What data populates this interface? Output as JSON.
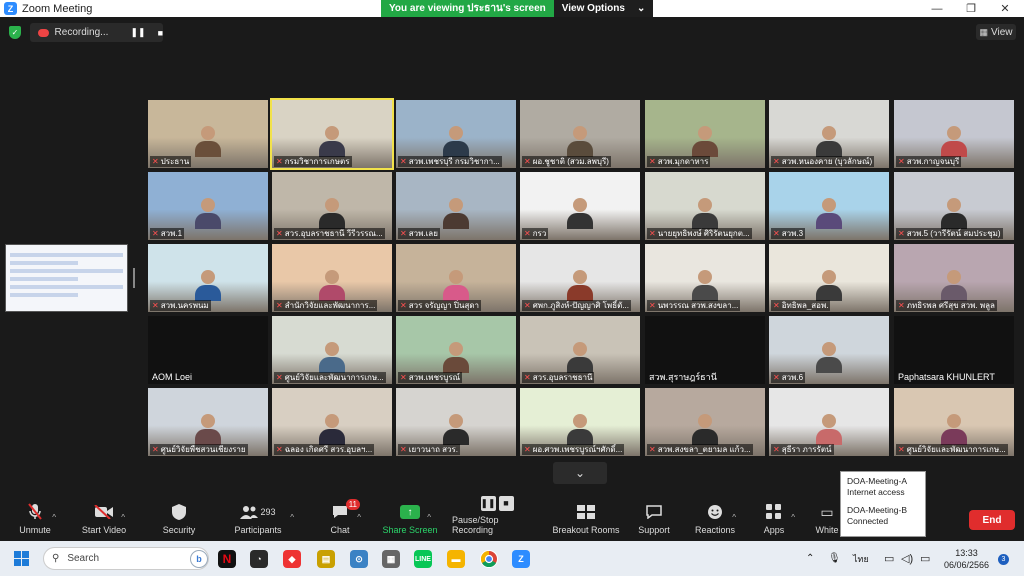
{
  "window": {
    "title": "Zoom Meeting",
    "banner_text": "You are viewing ประธาน's screen",
    "view_options": "View Options"
  },
  "top": {
    "recording_label": "Recording...",
    "view_label": "View"
  },
  "participants": [
    {
      "name": "ประธาน",
      "muted": true
    },
    {
      "name": "กรมวิชาการเกษตร",
      "muted": true
    },
    {
      "name": "สวพ.เพชรบุรี กรมวิชากา...",
      "muted": true
    },
    {
      "name": "ผอ.ชูชาติ (สวม.ลพบุรี)",
      "muted": true
    },
    {
      "name": "สวพ.มุกดาหาร",
      "muted": true
    },
    {
      "name": "สวพ.หนองคาย (บุวลักษณ์)",
      "muted": true
    },
    {
      "name": "สวพ.กาญจนบุรี",
      "muted": true
    },
    {
      "name": "สวพ.1",
      "muted": true
    },
    {
      "name": "สวร.อุบลราชธานี วีรีวรรณ...",
      "muted": true
    },
    {
      "name": "สวพ.เลย",
      "muted": true
    },
    {
      "name": "กรว",
      "muted": true
    },
    {
      "name": "นายยุทธิพงษ์ ศิริรัตนยุกต...",
      "muted": true
    },
    {
      "name": "สวพ.3",
      "muted": true
    },
    {
      "name": "สวพ.5 (วารีรัตน์ สมประชุม)",
      "muted": true
    },
    {
      "name": "สวพ.นครพนม",
      "muted": true
    },
    {
      "name": "สำนักวิจัยและพัฒนาการ...",
      "muted": true
    },
    {
      "name": "สวร จรัญญา ปิ่นสุดา",
      "muted": true
    },
    {
      "name": "ศพก.ภูสิงห์-ปัญญาศิ โพธิ์ตั...",
      "muted": true
    },
    {
      "name": "นพวรรณ สวพ.สงขลา...",
      "muted": true
    },
    {
      "name": "อิทธิพล_สอพ.",
      "muted": true
    },
    {
      "name": "ภทธิรพล ศรีสุข สวพ. พลูล",
      "muted": true
    },
    {
      "name": "AOM Loei",
      "muted": true
    },
    {
      "name": "ศูนย์วิจัยและพัฒนาการเกษ...",
      "muted": true
    },
    {
      "name": "สวพ.เพชรบูรณ์",
      "muted": true
    },
    {
      "name": "สวร.อุบลราชธานี",
      "muted": true
    },
    {
      "name": "สวพ.สุราษฎร์ธานี",
      "muted": true
    },
    {
      "name": "สวพ.6",
      "muted": true
    },
    {
      "name": "Paphatsara KHUNLERT",
      "muted": true
    },
    {
      "name": "ศูนย์วิจัยพืชสวนเชียงราย",
      "muted": true
    },
    {
      "name": "ฉลอง เกิดศรี สวร.อุบลฯ...",
      "muted": true
    },
    {
      "name": "เยาวนาถ สวร.",
      "muted": true
    },
    {
      "name": "ผอ.ศวพ.เพชรบูรณ์ฯศักดิ์...",
      "muted": true
    },
    {
      "name": "สวพ.สงขลา_ตยามล แก้ว...",
      "muted": true
    },
    {
      "name": "สุธีรา ภารรัตน์",
      "muted": true
    },
    {
      "name": "ศูนย์วิจัยและพัฒนาการเกษ...",
      "muted": true
    }
  ],
  "toolbar": {
    "unmute": "Unmute",
    "start_video": "Start Video",
    "security": "Security",
    "participants": "Participants",
    "participant_count": "293",
    "chat": "Chat",
    "chat_badge": "11",
    "share_screen": "Share Screen",
    "pause_stop_recording": "Pause/Stop Recording",
    "breakout_rooms": "Breakout Rooms",
    "support": "Support",
    "reactions": "Reactions",
    "apps": "Apps",
    "whiteboards": "White",
    "end": "End"
  },
  "tooltip": {
    "line1": "DOA-Meeting-A",
    "line2": "Internet access",
    "line3": "DOA-Meeting-B",
    "line4": "Connected"
  },
  "taskbar": {
    "search_placeholder": "Search",
    "language": "ไทย",
    "time": "13:33",
    "date": "06/06/2566",
    "notification_count": "3"
  }
}
